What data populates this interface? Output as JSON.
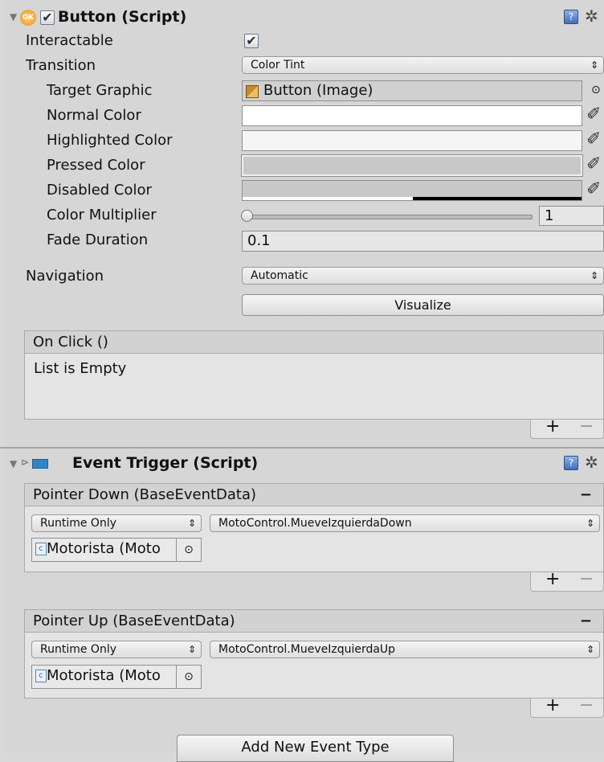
{
  "button_component": {
    "title": "Button (Script)",
    "ok_badge": "OK",
    "interactable_label": "Interactable",
    "interactable_checked": true,
    "transition_label": "Transition",
    "transition_value": "Color Tint",
    "target_graphic_label": "Target Graphic",
    "target_graphic_value": "Button (Image)",
    "normal_color_label": "Normal Color",
    "highlighted_color_label": "Highlighted Color",
    "pressed_color_label": "Pressed Color",
    "disabled_color_label": "Disabled Color",
    "color_multiplier_label": "Color Multiplier",
    "color_multiplier_value": "1",
    "color_multiplier_fraction": 0,
    "fade_duration_label": "Fade Duration",
    "fade_duration_value": "0.1",
    "navigation_label": "Navigation",
    "navigation_value": "Automatic",
    "visualize_label": "Visualize",
    "colors": {
      "normal": "#ffffff",
      "highlighted": "#f5f5f5",
      "pressed": "#c8c8c8",
      "disabled": "#c8c8c8"
    },
    "on_click": {
      "header": "On Click ()",
      "empty_text": "List is Empty",
      "add": "+",
      "remove": "−"
    }
  },
  "event_trigger_component": {
    "title": "Event Trigger (Script)",
    "entries": [
      {
        "header": "Pointer Down (BaseEventData)",
        "remove": "−",
        "runtime": "Runtime Only",
        "method": "MotoControl.MueveIzquierdaDown",
        "object": "Motorista (Moto",
        "add": "+",
        "remove_footer": "−"
      },
      {
        "header": "Pointer Up (BaseEventData)",
        "remove": "−",
        "runtime": "Runtime Only",
        "method": "MotoControl.MueveIzquierdaUp",
        "object": "Motorista (Moto",
        "add": "+",
        "remove_footer": "−"
      }
    ],
    "add_event_type_label": "Add New Event Type"
  },
  "icons": {
    "dropdown_arrow": "⇕",
    "foldout": "▼",
    "check": "✔",
    "pipette": "✐",
    "object_picker": "⊙",
    "gear": "✲"
  }
}
